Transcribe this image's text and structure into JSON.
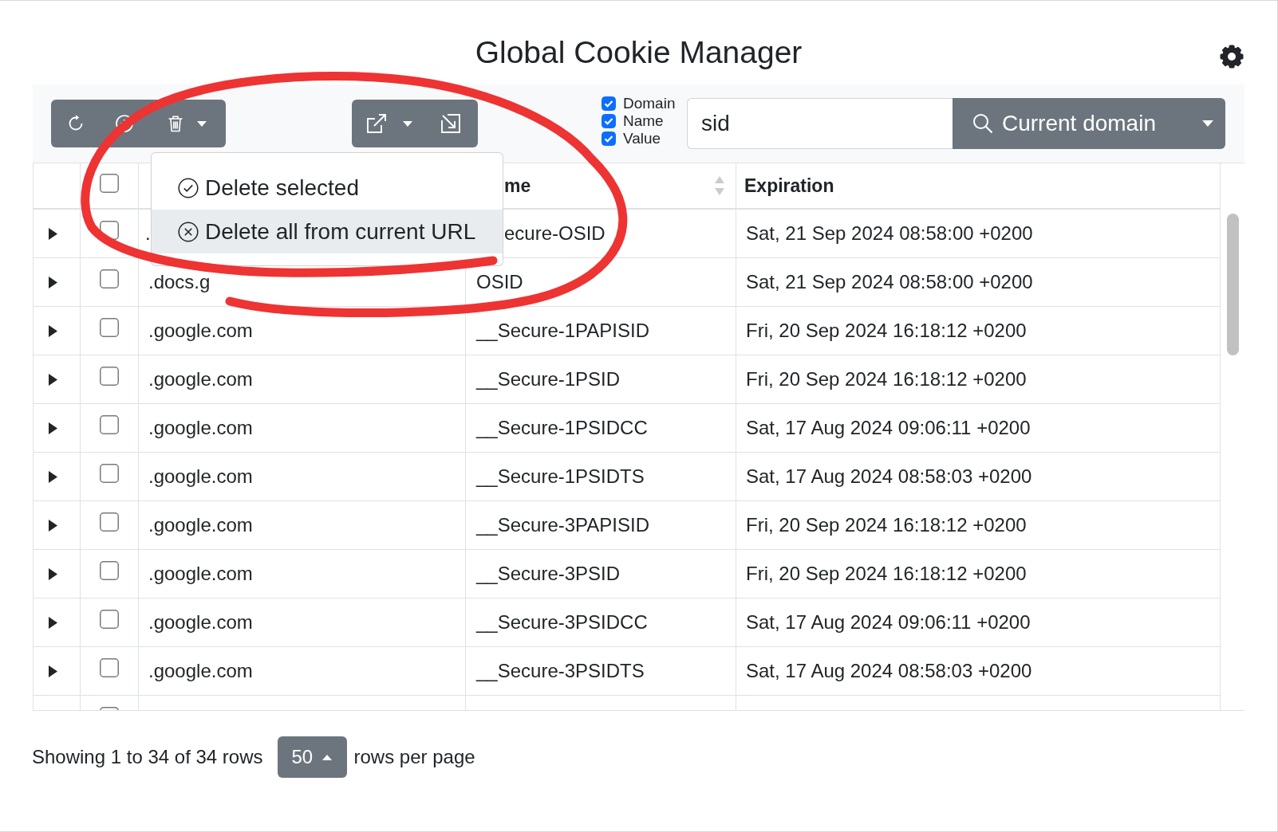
{
  "window": {
    "title": "Global Cookie Manager"
  },
  "toolbar": {
    "delete_menu": {
      "expanded": true,
      "items": [
        {
          "label": "Delete selected",
          "highlighted": false
        },
        {
          "label": "Delete all from current URL",
          "highlighted": true
        }
      ]
    }
  },
  "search": {
    "filters": [
      {
        "label": "Domain",
        "checked": true
      },
      {
        "label": "Name",
        "checked": true
      },
      {
        "label": "Value",
        "checked": true
      }
    ],
    "value": "sid",
    "scope_button": "Current domain"
  },
  "table": {
    "header_checked": false,
    "columns": [
      {
        "label": "me",
        "sortable": true
      },
      {
        "label": "Expiration",
        "sortable": false
      }
    ],
    "rows": [
      {
        "domain": ".",
        "name": "ecure-OSID",
        "expiration": "Sat, 21 Sep 2024 08:58:00 +0200",
        "checked": false
      },
      {
        "domain": ".docs.g",
        "name": "OSID",
        "expiration": "Sat, 21 Sep 2024 08:58:00 +0200",
        "checked": false
      },
      {
        "domain": ".google.com",
        "name": "__Secure-1PAPISID",
        "expiration": "Fri, 20 Sep 2024 16:18:12 +0200",
        "checked": false
      },
      {
        "domain": ".google.com",
        "name": "__Secure-1PSID",
        "expiration": "Fri, 20 Sep 2024 16:18:12 +0200",
        "checked": false
      },
      {
        "domain": ".google.com",
        "name": "__Secure-1PSIDCC",
        "expiration": "Sat, 17 Aug 2024 09:06:11 +0200",
        "checked": false
      },
      {
        "domain": ".google.com",
        "name": "__Secure-1PSIDTS",
        "expiration": "Sat, 17 Aug 2024 08:58:03 +0200",
        "checked": false
      },
      {
        "domain": ".google.com",
        "name": "__Secure-3PAPISID",
        "expiration": "Fri, 20 Sep 2024 16:18:12 +0200",
        "checked": false
      },
      {
        "domain": ".google.com",
        "name": "__Secure-3PSID",
        "expiration": "Fri, 20 Sep 2024 16:18:12 +0200",
        "checked": false
      },
      {
        "domain": ".google.com",
        "name": "__Secure-3PSIDCC",
        "expiration": "Sat, 17 Aug 2024 09:06:11 +0200",
        "checked": false
      },
      {
        "domain": ".google.com",
        "name": "__Secure-3PSIDTS",
        "expiration": "Sat, 17 Aug 2024 08:58:03 +0200",
        "checked": false
      },
      {
        "checked": false
      }
    ]
  },
  "footer": {
    "summary": "Showing 1 to 34 of 34 rows",
    "page_size": "50",
    "page_size_label": "rows per page"
  },
  "annotation": {
    "kind": "loop"
  }
}
